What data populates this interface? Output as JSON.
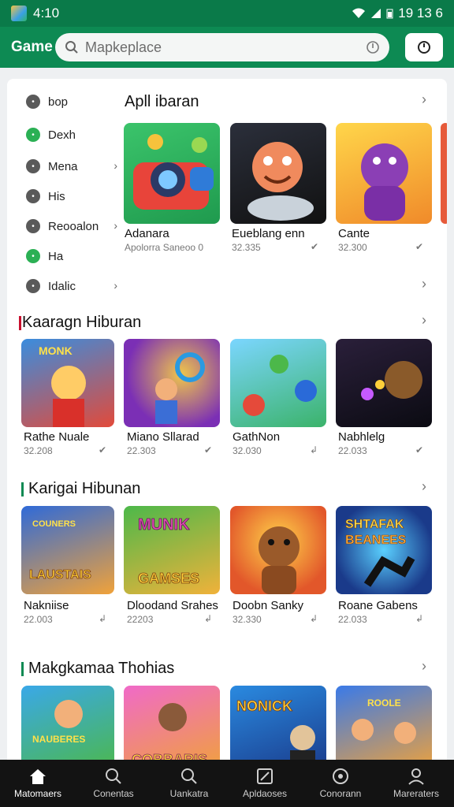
{
  "status": {
    "time": "4:10",
    "right_text": "19 13 6"
  },
  "appbar": {
    "brand": "Game",
    "search_placeholder": "Mapkeplace"
  },
  "sidebar": [
    {
      "label": "bop",
      "color": "#5a5a5a",
      "chevron": false
    },
    {
      "label": "Dexh",
      "color": "#2bb054",
      "chevron": false
    },
    {
      "label": "Mena",
      "color": "#5a5a5a",
      "chevron": true
    },
    {
      "label": "His",
      "color": "#5a5a5a",
      "chevron": false
    },
    {
      "label": "Reooalon",
      "color": "#5a5a5a",
      "chevron": true
    },
    {
      "label": "Ha",
      "color": "#2bb054",
      "chevron": false
    },
    {
      "label": "Idalic",
      "color": "#5a5a5a",
      "chevron": true
    }
  ],
  "top_section": {
    "title": "Apll ibaran",
    "cards": [
      {
        "title": "Adanara",
        "sub": "Apolorra Saneoo 0"
      },
      {
        "title": "Eueblang enn",
        "sub": "32.335"
      },
      {
        "title": "Cante",
        "sub": "32.300"
      }
    ]
  },
  "sections": [
    {
      "title": "Kaaragn Hiburan",
      "cards": [
        {
          "title": "Rathe Nuale",
          "sub": "32.208"
        },
        {
          "title": "Miano Sllarad",
          "sub": "22.303"
        },
        {
          "title": "GathNon",
          "sub": "32.030"
        },
        {
          "title": "Nabhlelg",
          "sub": "22.033"
        }
      ]
    },
    {
      "title": "Karigai Hibunan",
      "cards": [
        {
          "title": "Nakniise",
          "sub": "22.003"
        },
        {
          "title": "Dloodand Srahes",
          "sub": "22203"
        },
        {
          "title": "Doobn Sanky",
          "sub": "32.330"
        },
        {
          "title": "Roane Gabens",
          "sub": "22.033"
        }
      ]
    },
    {
      "title": "Makgkamaa Thohias",
      "cards": []
    }
  ],
  "art_text": {
    "s1c1": "MONK",
    "s2c1": "LAUSTAIS",
    "s2c1b": "COUNERS",
    "s2c2": "MUNIK",
    "s2c2b": "GAMSES",
    "s2c4": "SHTAFAK",
    "s2c4b": "BEANEES",
    "s3c1": "NAUBERES",
    "s3c2": "COBBARIS",
    "s3c3": "NONICK",
    "s3c4": "ROOLE"
  },
  "nav": [
    {
      "label": "Matomaers",
      "icon": "home-icon",
      "active": true
    },
    {
      "label": "Conentas",
      "icon": "search-icon",
      "active": false
    },
    {
      "label": "Uankatra",
      "icon": "search-icon",
      "active": false
    },
    {
      "label": "Apldaoses",
      "icon": "gallery-icon",
      "active": false
    },
    {
      "label": "Conorann",
      "icon": "compass-icon",
      "active": false
    },
    {
      "label": "Mareraters",
      "icon": "person-icon",
      "active": false
    }
  ],
  "colors": {
    "brand": "#0d8a53",
    "status": "#0a7a49",
    "nav": "#131313"
  }
}
